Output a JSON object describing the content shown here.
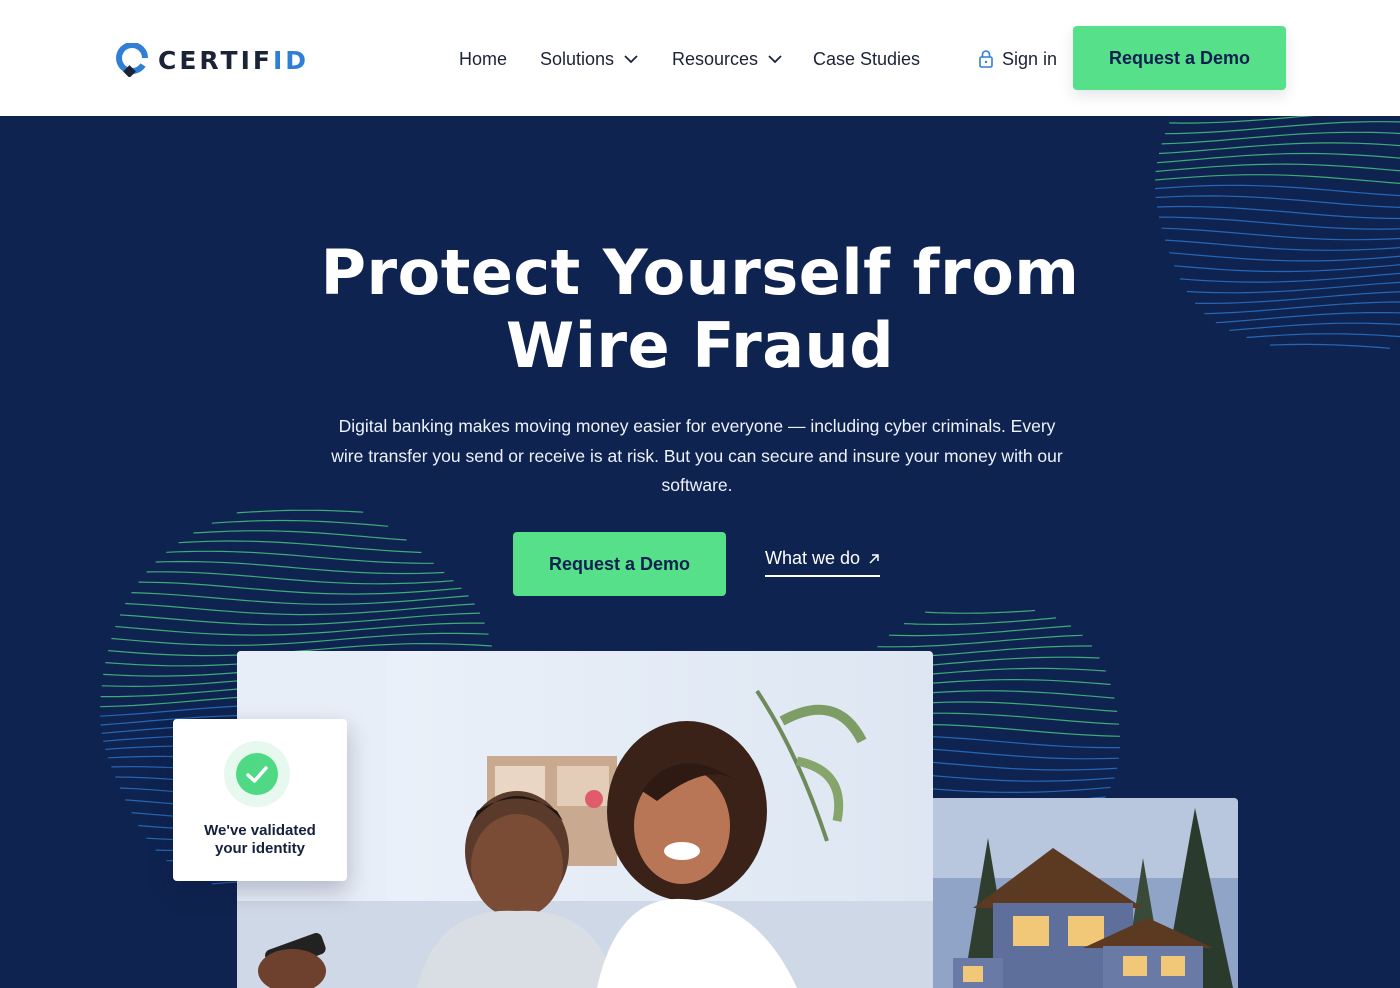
{
  "brand": {
    "name_main": "CERTIF",
    "name_accent": "ID",
    "logo_icon": "certifid-logo-icon",
    "accent_color": "#56e08a",
    "navy": "#0f2350",
    "blue": "#2f7fd7"
  },
  "nav": {
    "items": [
      {
        "label": "Home",
        "dropdown": false
      },
      {
        "label": "Solutions",
        "dropdown": true
      },
      {
        "label": "Resources",
        "dropdown": true
      },
      {
        "label": "Case Studies",
        "dropdown": false
      }
    ],
    "sign_in": "Sign in",
    "sign_in_icon": "lock-icon",
    "cta": "Request a Demo"
  },
  "hero": {
    "title_line1": "Protect Yourself from",
    "title_line2": "Wire Fraud",
    "subtitle": "Digital banking makes moving money easier for everyone — including cyber criminals. Every wire transfer you send or receive is at risk. But you can secure and insure your money with our software.",
    "cta_primary": "Request a Demo",
    "cta_secondary": "What we do",
    "cta_secondary_icon": "arrow-up-right-icon"
  },
  "validation_card": {
    "icon": "checkmark-icon",
    "line1": "We've validated",
    "line2": "your identity"
  }
}
